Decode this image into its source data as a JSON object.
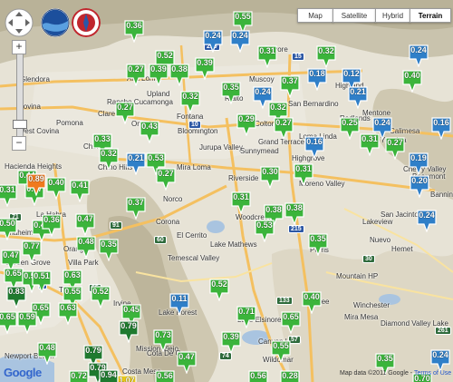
{
  "map_type_buttons": [
    {
      "label": "Map",
      "active": false
    },
    {
      "label": "Satellite",
      "active": false
    },
    {
      "label": "Hybrid",
      "active": false
    },
    {
      "label": "Terrain",
      "active": true
    }
  ],
  "logos": {
    "noaa": "NOAA",
    "nws": "NWS"
  },
  "zoom": {
    "plus": "+",
    "minus": "−"
  },
  "places": [
    "Glendora",
    "Covina",
    "West Covina",
    "Pomona",
    "Claremont",
    "Upland",
    "Rancho Cucamonga",
    "Ontario",
    "Fontana",
    "Rialto",
    "San Bernardino",
    "Highland",
    "Colton",
    "Grand Terrace",
    "Redlands",
    "Loma Linda",
    "Yucaipa",
    "Calimesa",
    "Bloomington",
    "Jurupa Valley",
    "Sunnymead",
    "Riverside",
    "Moreno Valley",
    "Chino",
    "Chino Hills",
    "Norco",
    "Corona",
    "Mira Loma",
    "Highgrove",
    "Hacienda Heights",
    "La Habra",
    "Anaheim",
    "Garden Grove",
    "Orange",
    "Villa Park",
    "Tustin",
    "Irvine",
    "Lake Forest",
    "Mission Viejo",
    "Costa Mesa",
    "Newport Beach",
    "Lake Elsinore",
    "Wildomar",
    "Perris",
    "Nuevo",
    "Lakeview",
    "Hemet",
    "San Jacinto",
    "Winchester",
    "Menifee",
    "Canyon Lake",
    "Lake Mathews",
    "Woodcrest",
    "El Cerrito",
    "Temescal Valley",
    "Diamond Valley Lake",
    "Mountain HP",
    "Beaumont",
    "Banning",
    "Cherry Valley",
    "Mentone",
    "Muscoy",
    "Devore",
    "Alta Loma",
    "Mira Mesa",
    "Cota De Caza"
  ],
  "markers": [
    {
      "value": "0.36",
      "color": "green"
    },
    {
      "value": "0.55",
      "color": "green"
    },
    {
      "value": "0.24",
      "color": "blue"
    },
    {
      "value": "0.24",
      "color": "blue"
    },
    {
      "value": "0.52",
      "color": "green"
    },
    {
      "value": "0.31",
      "color": "green"
    },
    {
      "value": "0.32",
      "color": "green"
    },
    {
      "value": "0.24",
      "color": "blue"
    },
    {
      "value": "0.39",
      "color": "green"
    },
    {
      "value": "0.27",
      "color": "green"
    },
    {
      "value": "0.38",
      "color": "green"
    },
    {
      "value": "0.39",
      "color": "green"
    },
    {
      "value": "0.37",
      "color": "green"
    },
    {
      "value": "0.18",
      "color": "blue"
    },
    {
      "value": "0.12",
      "color": "blue"
    },
    {
      "value": "0.40",
      "color": "green"
    },
    {
      "value": "0.35",
      "color": "green"
    },
    {
      "value": "0.24",
      "color": "blue"
    },
    {
      "value": "0.32",
      "color": "green"
    },
    {
      "value": "0.21",
      "color": "blue"
    },
    {
      "value": "0.32",
      "color": "green"
    },
    {
      "value": "0.27",
      "color": "green"
    },
    {
      "value": "0.43",
      "color": "green"
    },
    {
      "value": "0.29",
      "color": "green"
    },
    {
      "value": "0.27",
      "color": "green"
    },
    {
      "value": "0.25",
      "color": "green"
    },
    {
      "value": "0.24",
      "color": "blue"
    },
    {
      "value": "0.16",
      "color": "blue"
    },
    {
      "value": "0.33",
      "color": "green"
    },
    {
      "value": "0.16",
      "color": "blue"
    },
    {
      "value": "0.31",
      "color": "green"
    },
    {
      "value": "0.27",
      "color": "green"
    },
    {
      "value": "0.32",
      "color": "green"
    },
    {
      "value": "0.21",
      "color": "blue"
    },
    {
      "value": "0.53",
      "color": "green"
    },
    {
      "value": "0.19",
      "color": "blue"
    },
    {
      "value": "0.27",
      "color": "green"
    },
    {
      "value": "0.30",
      "color": "green"
    },
    {
      "value": "0.31",
      "color": "green"
    },
    {
      "value": "0.20",
      "color": "blue"
    },
    {
      "value": "0.44",
      "color": "green"
    },
    {
      "value": "0.47",
      "color": "green"
    },
    {
      "value": "0.40",
      "color": "green"
    },
    {
      "value": "0.41",
      "color": "green"
    },
    {
      "value": "0.31",
      "color": "green"
    },
    {
      "value": "0.89",
      "color": "orange"
    },
    {
      "value": "0.37",
      "color": "green"
    },
    {
      "value": "0.31",
      "color": "green"
    },
    {
      "value": "0.38",
      "color": "green"
    },
    {
      "value": "0.38",
      "color": "green"
    },
    {
      "value": "0.53",
      "color": "green"
    },
    {
      "value": "0.24",
      "color": "blue"
    },
    {
      "value": "0.42",
      "color": "green"
    },
    {
      "value": "0.36",
      "color": "green"
    },
    {
      "value": "0.47",
      "color": "green"
    },
    {
      "value": "0.50",
      "color": "green"
    },
    {
      "value": "0.35",
      "color": "green"
    },
    {
      "value": "0.47",
      "color": "green"
    },
    {
      "value": "0.48",
      "color": "green"
    },
    {
      "value": "0.35",
      "color": "green"
    },
    {
      "value": "0.77",
      "color": "green"
    },
    {
      "value": "0.65",
      "color": "green"
    },
    {
      "value": "0.53",
      "color": "green"
    },
    {
      "value": "0.51",
      "color": "green"
    },
    {
      "value": "0.63",
      "color": "green"
    },
    {
      "value": "0.83",
      "color": "darkgreen"
    },
    {
      "value": "0.55",
      "color": "green"
    },
    {
      "value": "0.52",
      "color": "green"
    },
    {
      "value": "0.52",
      "color": "green"
    },
    {
      "value": "0.11",
      "color": "blue"
    },
    {
      "value": "0.45",
      "color": "green"
    },
    {
      "value": "0.65",
      "color": "green"
    },
    {
      "value": "0.63",
      "color": "green"
    },
    {
      "value": "0.59",
      "color": "green"
    },
    {
      "value": "0.65",
      "color": "green"
    },
    {
      "value": "0.71",
      "color": "green"
    },
    {
      "value": "0.65",
      "color": "green"
    },
    {
      "value": "0.40",
      "color": "green"
    },
    {
      "value": "0.39",
      "color": "green"
    },
    {
      "value": "0.48",
      "color": "green"
    },
    {
      "value": "0.79",
      "color": "darkgreen"
    },
    {
      "value": "0.79",
      "color": "darkgreen"
    },
    {
      "value": "0.79",
      "color": "darkgreen"
    },
    {
      "value": "0.73",
      "color": "green"
    },
    {
      "value": "0.47",
      "color": "green"
    },
    {
      "value": "0.55",
      "color": "green"
    },
    {
      "value": "0.35",
      "color": "green"
    },
    {
      "value": "0.94",
      "color": "darkgreen"
    },
    {
      "value": "1.07",
      "color": "yellow"
    },
    {
      "value": "0.56",
      "color": "green"
    },
    {
      "value": "0.72",
      "color": "green"
    },
    {
      "value": "0.56",
      "color": "green"
    },
    {
      "value": "0.28",
      "color": "green"
    },
    {
      "value": "0.70",
      "color": "green"
    },
    {
      "value": "0.24",
      "color": "blue"
    },
    {
      "value": "0.20",
      "color": "blue"
    }
  ],
  "shields": [
    "210",
    "10",
    "15",
    "91",
    "60",
    "215",
    "74",
    "5",
    "55",
    "57",
    "71",
    "133",
    "261",
    "30"
  ],
  "google_logo": "Google",
  "credits": {
    "text": "Map data ©2011 Google -",
    "link": "Terms of Use"
  },
  "colors": {
    "green": "#3bb43b",
    "blue": "#2f7fc8",
    "orange": "#f07a1e",
    "yellow": "#e8c817",
    "darkgreen": "#1f7a2f"
  }
}
